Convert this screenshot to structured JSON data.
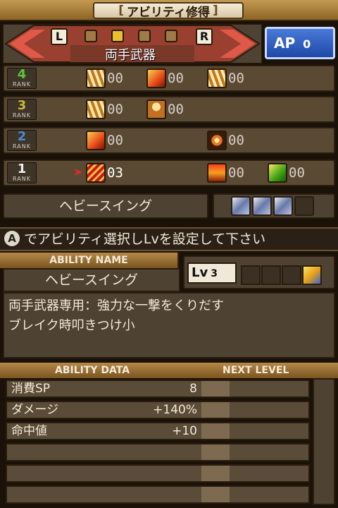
{
  "title": {
    "text": "アビリティ修得"
  },
  "weapon": {
    "name": "両手武器",
    "left_button": "L",
    "right_button": "R",
    "pages": [
      false,
      true,
      false,
      false,
      false
    ]
  },
  "ap": {
    "label": "AP",
    "value": "0"
  },
  "ranks": [
    {
      "number": "4",
      "word": "RANK",
      "color": "#58c838",
      "skills": [
        {
          "icon": "claw-icon",
          "count": "00"
        },
        {
          "icon": "fire-slash-icon",
          "count": "00"
        },
        {
          "icon": "claw-icon",
          "count": "00"
        }
      ]
    },
    {
      "number": "3",
      "word": "RANK",
      "color": "#c8b838",
      "skills": [
        {
          "icon": "claw-icon",
          "count": "00"
        },
        {
          "icon": "figure-icon",
          "count": "00"
        }
      ]
    },
    {
      "number": "2",
      "word": "RANK",
      "color": "#4888d8",
      "skills": [
        {
          "icon": "fire-slash-icon",
          "count": "00"
        },
        {
          "icon": "burst-icon",
          "count": "00"
        }
      ]
    },
    {
      "number": "1",
      "word": "RANK",
      "color": "#f0f0f0",
      "skills": [
        {
          "icon": "heavy-swing-icon",
          "count": "03",
          "selected": true
        },
        {
          "icon": "flame-burst-icon",
          "count": "00"
        },
        {
          "icon": "green-slash-icon",
          "count": "00"
        }
      ]
    }
  ],
  "selected_ability": {
    "name": "ヘビースイング"
  },
  "instruction": {
    "key": "A",
    "text": "でアビリティ選択しLvを設定して下さい"
  },
  "ability_name": {
    "header": "ABILITY NAME",
    "name": "ヘビースイング",
    "level_label": "Lv",
    "level_value": "3",
    "description_line1": "両手武器専用：強力な一撃をくりだす",
    "description_line2": "ブレイク時叩きつけ小"
  },
  "ability_data": {
    "header": "ABILITY DATA",
    "next_header": "NEXT LEVEL",
    "rows": [
      {
        "label": "消費SP",
        "value": "8"
      },
      {
        "label": "ダメージ",
        "value": "+140%"
      },
      {
        "label": "命中値",
        "value": "+10"
      },
      {
        "label": "",
        "value": ""
      },
      {
        "label": "",
        "value": ""
      },
      {
        "label": "",
        "value": ""
      }
    ]
  },
  "colors": {
    "accent": "#e8c030",
    "ap_blue": "#2a58c0",
    "panel": "#4e4232",
    "selection_arrow": "#e02828"
  }
}
